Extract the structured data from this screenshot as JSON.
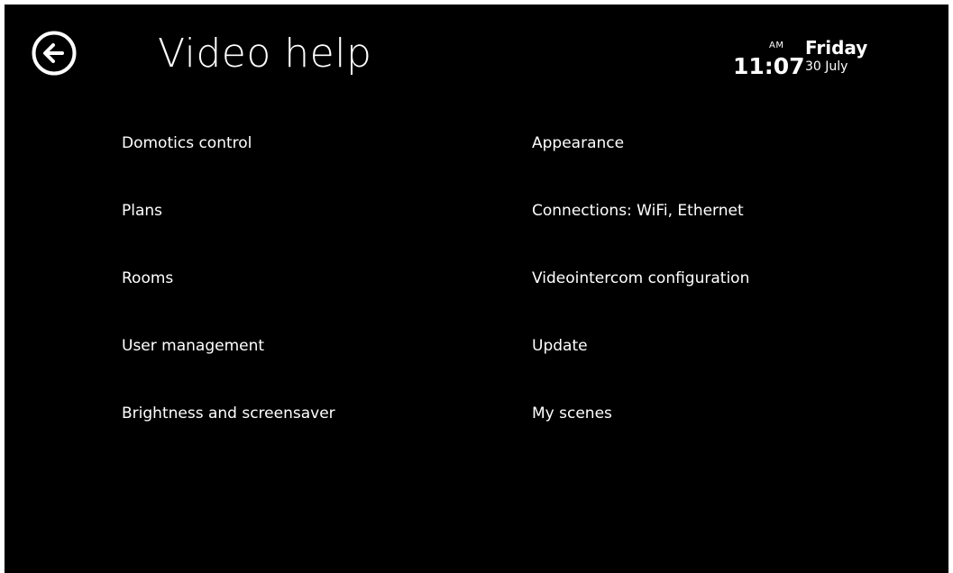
{
  "header": {
    "back_icon": "arrow-left-circle-icon",
    "title": "Video help",
    "clock": {
      "ampm": "AM",
      "time": "11:07",
      "weekday": "Friday",
      "date": "30 July"
    }
  },
  "menu": {
    "left": [
      {
        "label": "Domotics control"
      },
      {
        "label": "Plans"
      },
      {
        "label": "Rooms"
      },
      {
        "label": "User management"
      },
      {
        "label": "Brightness and screensaver"
      }
    ],
    "right": [
      {
        "label": "Appearance"
      },
      {
        "label": "Connections: WiFi, Ethernet"
      },
      {
        "label": "Videointercom configuration"
      },
      {
        "label": "Update"
      },
      {
        "label": "My scenes"
      }
    ]
  },
  "colors": {
    "background": "#000000",
    "text": "#ffffff",
    "frame": "#ffffff"
  }
}
